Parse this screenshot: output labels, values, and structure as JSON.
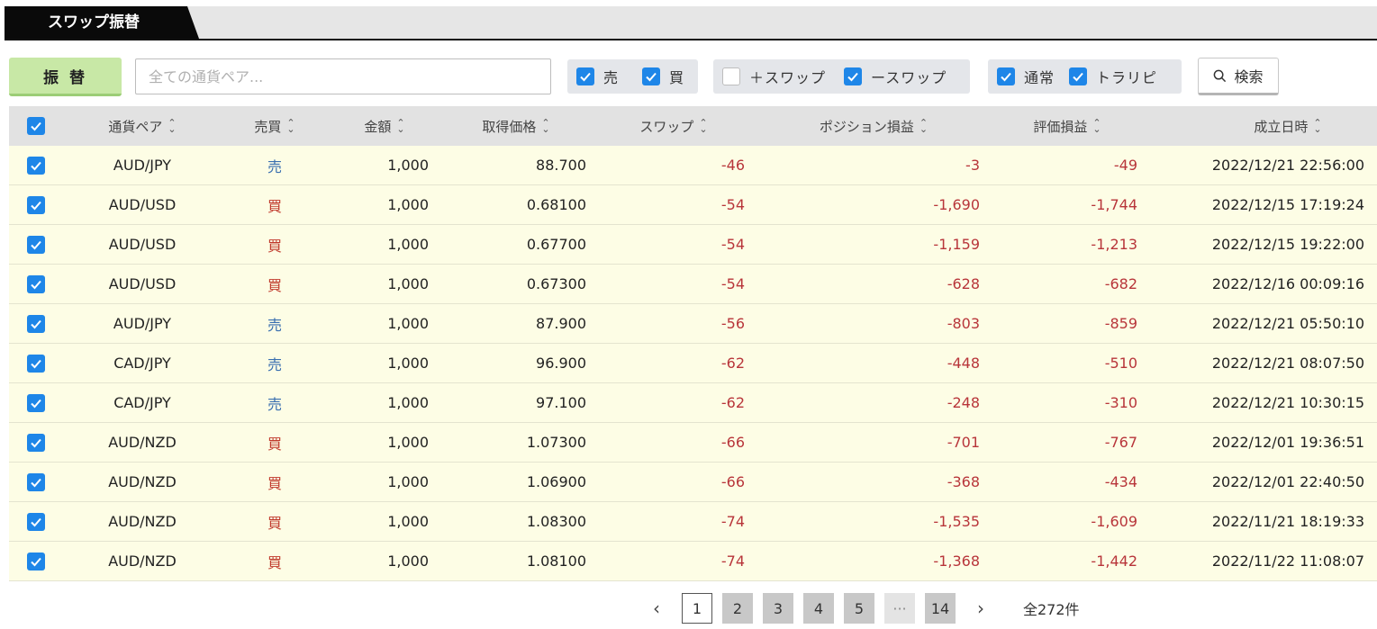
{
  "tab": {
    "title": "スワップ振替"
  },
  "toolbar": {
    "transfer_label": "振 替",
    "pair_placeholder": "全ての通貨ペア...",
    "filters": {
      "sell": {
        "label": "売",
        "checked": true
      },
      "buy": {
        "label": "買",
        "checked": true
      },
      "plus_swap": {
        "label": "＋スワップ",
        "checked": false
      },
      "minus_swap": {
        "label": "ースワップ",
        "checked": true
      },
      "normal": {
        "label": "通常",
        "checked": true
      },
      "trailing": {
        "label": "トラリピ",
        "checked": true
      }
    },
    "search_label": "検索"
  },
  "table": {
    "headers": {
      "pair": "通貨ペア",
      "side": "売買",
      "amount": "金額",
      "price": "取得価格",
      "swap": "スワップ",
      "position_pl": "ポジション損益",
      "eval_pl": "評価損益",
      "date": "成立日時"
    },
    "rows": [
      {
        "pair": "AUD/JPY",
        "side": "売",
        "amount": "1,000",
        "price": "88.700",
        "swap": "-46",
        "position_pl": "-3",
        "eval_pl": "-49",
        "date": "2022/12/21 22:56:00"
      },
      {
        "pair": "AUD/USD",
        "side": "買",
        "amount": "1,000",
        "price": "0.68100",
        "swap": "-54",
        "position_pl": "-1,690",
        "eval_pl": "-1,744",
        "date": "2022/12/15 17:19:24"
      },
      {
        "pair": "AUD/USD",
        "side": "買",
        "amount": "1,000",
        "price": "0.67700",
        "swap": "-54",
        "position_pl": "-1,159",
        "eval_pl": "-1,213",
        "date": "2022/12/15 19:22:00"
      },
      {
        "pair": "AUD/USD",
        "side": "買",
        "amount": "1,000",
        "price": "0.67300",
        "swap": "-54",
        "position_pl": "-628",
        "eval_pl": "-682",
        "date": "2022/12/16 00:09:16"
      },
      {
        "pair": "AUD/JPY",
        "side": "売",
        "amount": "1,000",
        "price": "87.900",
        "swap": "-56",
        "position_pl": "-803",
        "eval_pl": "-859",
        "date": "2022/12/21 05:50:10"
      },
      {
        "pair": "CAD/JPY",
        "side": "売",
        "amount": "1,000",
        "price": "96.900",
        "swap": "-62",
        "position_pl": "-448",
        "eval_pl": "-510",
        "date": "2022/12/21 08:07:50"
      },
      {
        "pair": "CAD/JPY",
        "side": "売",
        "amount": "1,000",
        "price": "97.100",
        "swap": "-62",
        "position_pl": "-248",
        "eval_pl": "-310",
        "date": "2022/12/21 10:30:15"
      },
      {
        "pair": "AUD/NZD",
        "side": "買",
        "amount": "1,000",
        "price": "1.07300",
        "swap": "-66",
        "position_pl": "-701",
        "eval_pl": "-767",
        "date": "2022/12/01 19:36:51"
      },
      {
        "pair": "AUD/NZD",
        "side": "買",
        "amount": "1,000",
        "price": "1.06900",
        "swap": "-66",
        "position_pl": "-368",
        "eval_pl": "-434",
        "date": "2022/12/01 22:40:50"
      },
      {
        "pair": "AUD/NZD",
        "side": "買",
        "amount": "1,000",
        "price": "1.08300",
        "swap": "-74",
        "position_pl": "-1,535",
        "eval_pl": "-1,609",
        "date": "2022/11/21 18:19:33"
      },
      {
        "pair": "AUD/NZD",
        "side": "買",
        "amount": "1,000",
        "price": "1.08100",
        "swap": "-74",
        "position_pl": "-1,368",
        "eval_pl": "-1,442",
        "date": "2022/11/22 11:08:07"
      }
    ]
  },
  "pagination": {
    "prev_label": "‹",
    "next_label": "›",
    "pages": [
      "1",
      "2",
      "3",
      "4",
      "5"
    ],
    "ellipsis": "···",
    "last_page": "14",
    "current": "1",
    "total_label": "全272件"
  },
  "colors": {
    "accent_check": "#1e86e8",
    "sell_text": "#3a6fb0",
    "buy_text": "#c0392b",
    "negative_text": "#b8353a",
    "row_background": "#fdfde5",
    "transfer_button": "#c8e8a6"
  }
}
